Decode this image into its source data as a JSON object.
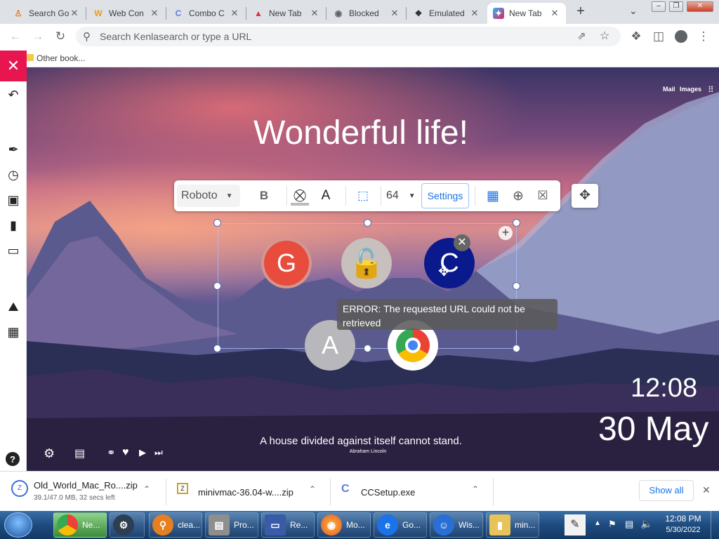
{
  "tabs": [
    {
      "title": "Search Go",
      "icon": "orange-person-icon"
    },
    {
      "title": "Web Con",
      "icon": "orange-w-icon"
    },
    {
      "title": "Combo C",
      "icon": "blue-c-icon"
    },
    {
      "title": "New Tab",
      "icon": "red-tab-icon"
    },
    {
      "title": "Blocked",
      "icon": "globe-icon"
    },
    {
      "title": "Emulated",
      "icon": "chip-icon"
    },
    {
      "title": "New Tab",
      "icon": "blue-pink-icon",
      "active": true
    }
  ],
  "omnibox": {
    "placeholder": "Search Kenlasearch or type a URL"
  },
  "bookmarks": {
    "other": "Other book..."
  },
  "page": {
    "title": "Wonderful life!",
    "top_links": {
      "mail": "Mail",
      "images": "Images"
    },
    "clock": {
      "time": "12:08",
      "date": "30 May"
    },
    "quote": {
      "text": "A house divided against itself cannot stand.",
      "author": "Abraham Lincoln"
    }
  },
  "editor": {
    "font": "Roboto",
    "bold": "B",
    "color_letter": "A",
    "size": "64",
    "settings": "Settings"
  },
  "tiles": [
    {
      "letter": "G",
      "color": "#e74c3c"
    },
    {
      "letter": "",
      "color": "#c8c0bc"
    },
    {
      "letter": "C",
      "color": "#0a1a8c"
    },
    {
      "letter": "A",
      "color": "#b8b8bc"
    },
    {
      "letter": "",
      "color": "#ffffff"
    }
  ],
  "error": {
    "text": "ERROR: The requested URL could not be retrieved"
  },
  "downloads": [
    {
      "name": "Old_World_Mac_Ro....zip",
      "status": "39.1/47.0 MB, 32 secs left"
    },
    {
      "name": "minivmac-36.04-w....zip",
      "status": ""
    },
    {
      "name": "CCSetup.exe",
      "status": ""
    }
  ],
  "show_all": "Show all",
  "taskbar": {
    "items": [
      {
        "label": "Ne...",
        "color": "#3a8a3a"
      },
      {
        "label": "",
        "color": "#2c3e50"
      },
      {
        "label": "clea...",
        "color": "#e67e22"
      },
      {
        "label": "Pro...",
        "color": "#8e8e8e"
      },
      {
        "label": "Re...",
        "color": "#3a5ca8"
      },
      {
        "label": "Mo...",
        "color": "#e55b1f"
      },
      {
        "label": "Go...",
        "color": "#1a73e8"
      },
      {
        "label": "Wis...",
        "color": "#2a6fd6"
      },
      {
        "label": "min...",
        "color": "#e8c35a"
      }
    ],
    "time": "12:08 PM",
    "date": "5/30/2022"
  }
}
